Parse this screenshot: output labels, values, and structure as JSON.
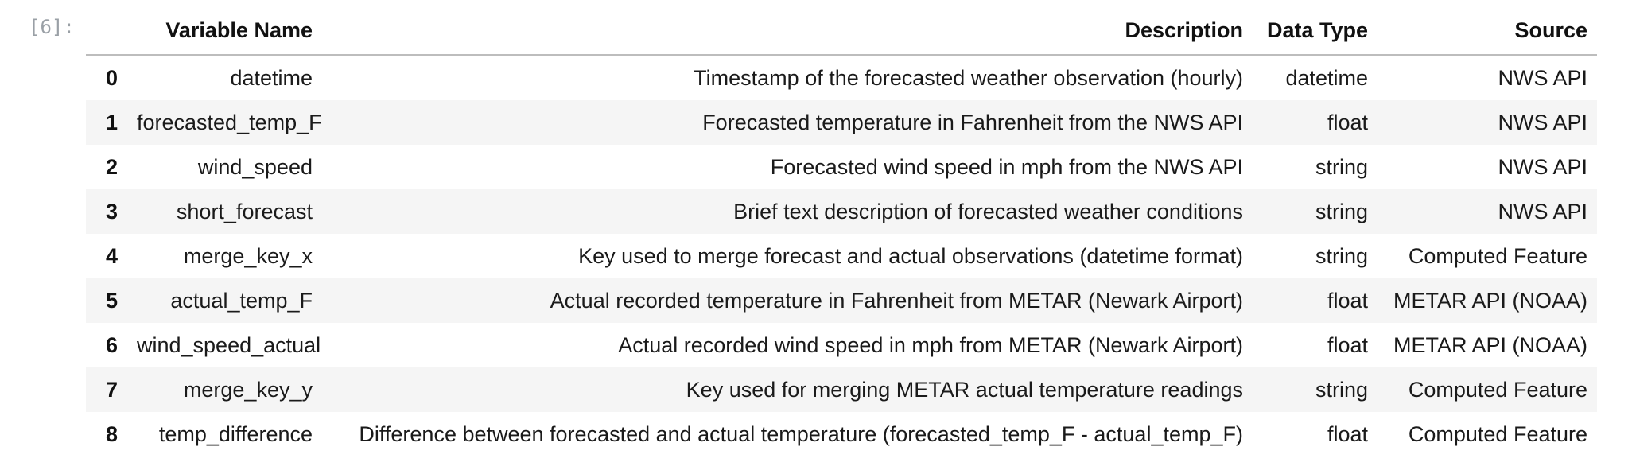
{
  "cell": {
    "prompt": "[6]:"
  },
  "table": {
    "headers": {
      "index": "",
      "variable_name": "Variable Name",
      "description": "Description",
      "data_type": "Data Type",
      "source": "Source"
    },
    "rows": [
      {
        "index": "0",
        "variable_name": "datetime",
        "description": "Timestamp of the forecasted weather observation (hourly)",
        "data_type": "datetime",
        "source": "NWS API"
      },
      {
        "index": "1",
        "variable_name": "forecasted_temp_F",
        "description": "Forecasted temperature in Fahrenheit from the NWS API",
        "data_type": "float",
        "source": "NWS API"
      },
      {
        "index": "2",
        "variable_name": "wind_speed",
        "description": "Forecasted wind speed in mph from the NWS API",
        "data_type": "string",
        "source": "NWS API"
      },
      {
        "index": "3",
        "variable_name": "short_forecast",
        "description": "Brief text description of forecasted weather conditions",
        "data_type": "string",
        "source": "NWS API"
      },
      {
        "index": "4",
        "variable_name": "merge_key_x",
        "description": "Key used to merge forecast and actual observations (datetime format)",
        "data_type": "string",
        "source": "Computed Feature"
      },
      {
        "index": "5",
        "variable_name": "actual_temp_F",
        "description": "Actual recorded temperature in Fahrenheit from METAR (Newark Airport)",
        "data_type": "float",
        "source": "METAR API (NOAA)"
      },
      {
        "index": "6",
        "variable_name": "wind_speed_actual",
        "description": "Actual recorded wind speed in mph from METAR (Newark Airport)",
        "data_type": "float",
        "source": "METAR API (NOAA)"
      },
      {
        "index": "7",
        "variable_name": "merge_key_y",
        "description": "Key used for merging METAR actual temperature readings",
        "data_type": "string",
        "source": "Computed Feature"
      },
      {
        "index": "8",
        "variable_name": "temp_difference",
        "description": "Difference between forecasted and actual temperature (forecasted_temp_F - actual_temp_F)",
        "data_type": "float",
        "source": "Computed Feature"
      }
    ]
  }
}
